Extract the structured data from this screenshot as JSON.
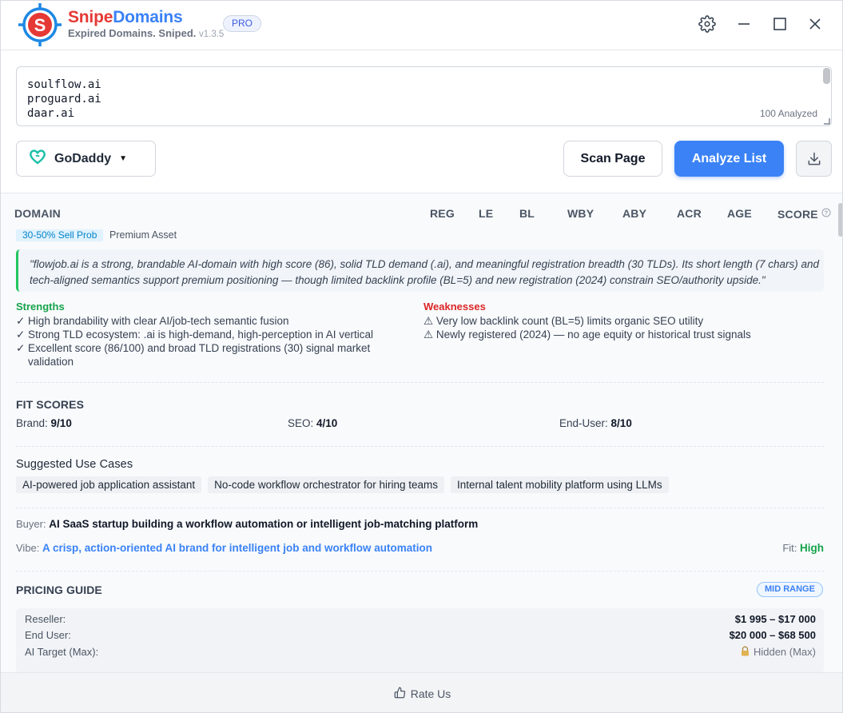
{
  "app": {
    "name_part1": "Snipe",
    "name_part2": "Domains",
    "tagline": "Expired Domains. Sniped.",
    "version": "v1.3.5",
    "badge": "PRO"
  },
  "icons": {
    "logo": "crosshair-s-logo-icon",
    "settings": "gear-icon",
    "minimize": "minimize-icon",
    "maximize": "maximize-icon",
    "close": "close-icon",
    "registrar": "godaddy-logo-icon",
    "download": "download-icon",
    "help": "help-circle-icon",
    "lock": "lock-icon",
    "thumbs_up": "thumbs-up-icon"
  },
  "colors": {
    "accent": "#3b82f6",
    "brand_red": "#e53935",
    "success": "#16a34a",
    "danger": "#dc2626"
  },
  "input": {
    "lines": [
      "soulflow.ai",
      "proguard.ai",
      "daar.ai"
    ],
    "analyzed_count": "100 Analyzed"
  },
  "toolbar": {
    "registrar": "GoDaddy",
    "scan_label": "Scan Page",
    "analyze_label": "Analyze List"
  },
  "columns": {
    "domain": "DOMAIN",
    "reg": "REG",
    "le": "LE",
    "bl": "BL",
    "wby": "WBY",
    "aby": "ABY",
    "acr": "ACR",
    "age": "AGE",
    "score": "SCORE"
  },
  "analysis": {
    "sell_prob": "30-50% Sell Prob",
    "asset_class": "Premium Asset",
    "quote_line1": "\"flowjob.ai is a strong, brandable AI-domain with high score (86), solid TLD demand (.ai), and meaningful registration breadth (30 TLDs). Its short length (7 chars) and",
    "quote_line2": "tech-aligned semantics support premium positioning — though limited backlink profile (BL=5) and new registration (2024) constrain SEO/authority upside.\"",
    "strengths_title": "Strengths",
    "strengths": [
      "✓ High brandability with clear AI/job-tech semantic fusion",
      "✓ Strong TLD ecosystem: .ai is high-demand, high-perception in AI vertical",
      "✓ Excellent score (86/100) and broad TLD registrations (30) signal market validation"
    ],
    "weaknesses_title": "Weaknesses",
    "weaknesses": [
      "⚠ Very low backlink count (BL=5) limits organic SEO utility",
      "⚠ Newly registered (2024) — no age equity or historical trust signals"
    ],
    "fit_scores_title": "FIT SCORES",
    "fit_brand_label": "Brand:",
    "fit_brand_value": "9/10",
    "fit_brand_score": 9,
    "fit_seo_label": "SEO:",
    "fit_seo_value": "4/10",
    "fit_seo_score": 4,
    "fit_enduser_label": "End-User:",
    "fit_enduser_value": "8/10",
    "fit_enduser_score": 8,
    "use_cases_title": "Suggested Use Cases",
    "use_cases": [
      "AI-powered job application assistant",
      "No-code workflow orchestrator for hiring teams",
      "Internal talent mobility platform using LLMs"
    ],
    "buyer_label": "Buyer:",
    "buyer_value": "AI SaaS startup building a workflow automation or intelligent job-matching platform",
    "vibe_label": "Vibe:",
    "vibe_value": "A crisp, action-oriented AI brand for intelligent job and workflow automation",
    "fit_label": "Fit:",
    "fit_value": "High",
    "pricing_title": "PRICING GUIDE",
    "pricing_tier": "MID RANGE",
    "reseller_label": "Reseller:",
    "reseller_value": "$1 995 – $17 000",
    "enduser_label": "End User:",
    "enduser_value": "$20 000 – $68 500",
    "ai_target_label": "AI Target (Max):",
    "ai_target_value": "Hidden (Max)"
  },
  "footer": {
    "rate_label": "Rate Us"
  }
}
